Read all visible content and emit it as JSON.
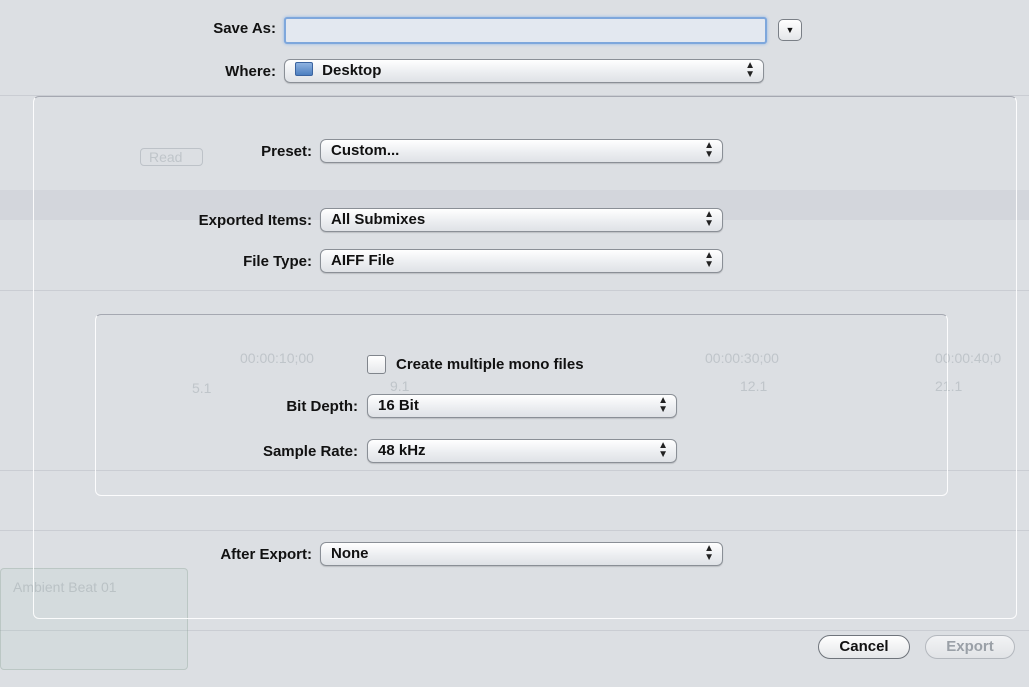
{
  "save_as": {
    "label": "Save As:",
    "value": "",
    "expand_icon": "chevron-down-icon"
  },
  "where": {
    "label": "Where:",
    "value": "Desktop",
    "icon": "folder-icon"
  },
  "preset": {
    "label": "Preset:",
    "value": "Custom..."
  },
  "exported_items": {
    "label": "Exported Items:",
    "value": "All Submixes"
  },
  "file_type": {
    "label": "File Type:",
    "value": "AIFF File"
  },
  "options": {
    "mono_checkbox_label": "Create multiple mono files",
    "mono_checked": false,
    "bit_depth": {
      "label": "Bit Depth:",
      "value": "16 Bit"
    },
    "sample_rate": {
      "label": "Sample Rate:",
      "value": "48 kHz"
    }
  },
  "after_export": {
    "label": "After Export:",
    "value": "None"
  },
  "buttons": {
    "cancel": "Cancel",
    "export": "Export"
  },
  "background": {
    "read_label": "Read",
    "clip_name": "Ambient Beat 01",
    "timecodes": [
      "00:00:10;00",
      "00:00:30;00",
      "00:00:40;0"
    ],
    "bars": [
      "5.1",
      "9.1",
      "12.1",
      "21.1"
    ]
  }
}
